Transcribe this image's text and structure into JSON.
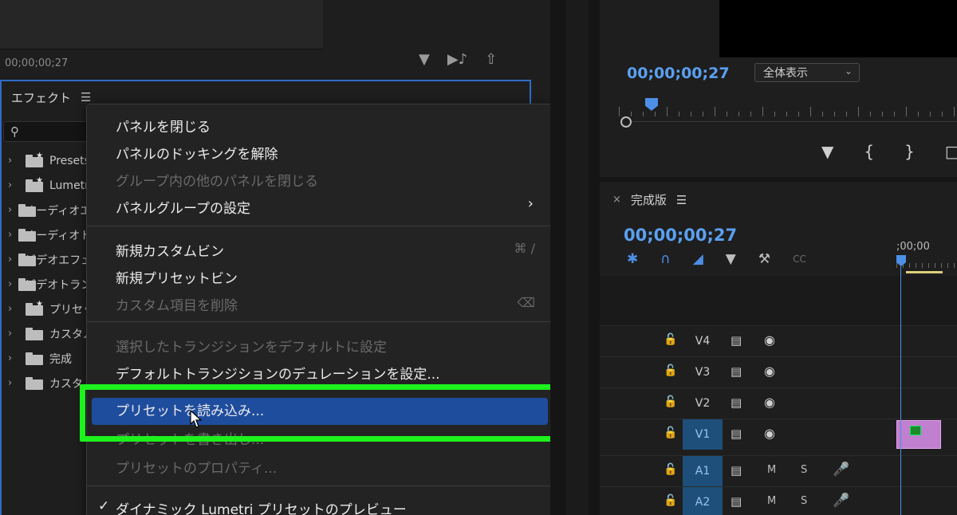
{
  "source_monitor": {
    "timecode": "00;00;00;27",
    "icons": [
      "filter-icon",
      "insert-icon",
      "export-icon"
    ]
  },
  "effects_panel": {
    "title": "エフェクト",
    "search_placeholder": "",
    "tree": [
      {
        "label": "Presets",
        "starred": true
      },
      {
        "label": "Lumetri",
        "starred": true
      },
      {
        "label": "オーディオエフェクト",
        "starred": false
      },
      {
        "label": "オーディオトランジション",
        "starred": false
      },
      {
        "label": "ビデオエフェクト",
        "starred": false
      },
      {
        "label": "ビデオトランジション",
        "starred": false
      },
      {
        "label": "プリセット",
        "starred": true
      },
      {
        "label": "カスタム",
        "starred": false
      },
      {
        "label": "完成",
        "starred": false
      },
      {
        "label": "カスタム",
        "starred": false
      }
    ]
  },
  "context_menu": {
    "items": [
      {
        "label": "パネルを閉じる",
        "enabled": true
      },
      {
        "label": "パネルのドッキングを解除",
        "enabled": true
      },
      {
        "label": "グループ内の他のパネルを閉じる",
        "enabled": false
      },
      {
        "label": "パネルグループの設定",
        "enabled": true,
        "submenu": "›"
      },
      {
        "label": "新規カスタムビン",
        "enabled": true,
        "shortcut": "⌘ /"
      },
      {
        "label": "新規プリセットビン",
        "enabled": true
      },
      {
        "label": "カスタム項目を削除",
        "enabled": false,
        "shortcut": "⌫"
      },
      {
        "label": "選択したトランジションをデフォルトに設定",
        "enabled": false
      },
      {
        "label": "デフォルトトランジションのデュレーションを設定...",
        "enabled": true
      },
      {
        "label": "プリセットを読み込み...",
        "enabled": true,
        "highlighted": true
      },
      {
        "label": "プリセットを書き出し...",
        "enabled": false
      },
      {
        "label": "プリセットのプロパティ...",
        "enabled": false
      },
      {
        "label": "ダイナミック Lumetri プリセットのプレビュー",
        "enabled": true,
        "checked": true,
        "check": "✓"
      }
    ]
  },
  "program_monitor": {
    "timecode": "00;00;00;27",
    "zoom": "全体表示",
    "zoom_arrow": "⌄"
  },
  "timeline": {
    "close": "×",
    "title": "完成版",
    "timecode": "00;00;00;27",
    "ruler_label": ";00;00",
    "tracks": [
      {
        "name": "V4",
        "type": "video",
        "targeted": false
      },
      {
        "name": "V3",
        "type": "video",
        "targeted": false
      },
      {
        "name": "V2",
        "type": "video",
        "targeted": false
      },
      {
        "name": "V1",
        "type": "video",
        "targeted": true
      },
      {
        "name": "A1",
        "type": "audio",
        "targeted": true,
        "mute": "M",
        "solo": "S"
      },
      {
        "name": "A2",
        "type": "audio",
        "targeted": true,
        "mute": "M",
        "solo": "S"
      }
    ],
    "tool_cc": "CC"
  },
  "colors": {
    "accent_blue": "#4d8fe6",
    "highlight": "#1f4d9e",
    "annotation_green": "#1cf21c",
    "clip_pink": "#c17fcf"
  }
}
